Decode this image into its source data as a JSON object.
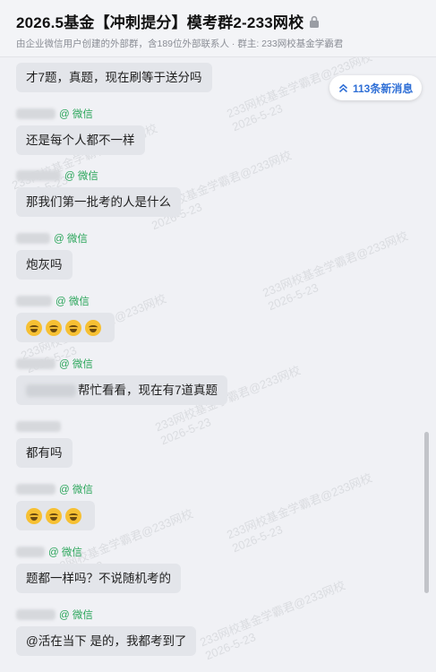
{
  "header": {
    "title": "2026.5基金【冲刺提分】模考群2-233网校",
    "subtitle": "由企业微信用户创建的外部群，含189位外部联系人 · 群主: 233网校基金学霸君"
  },
  "new_messages": {
    "label": "113条新消息"
  },
  "wechat_tag": "@ 微信",
  "messages": [
    {
      "text": "才7题，真题，现在刷等于送分吗"
    },
    {
      "text": "还是每个人都不一样"
    },
    {
      "text": "那我们第一批考的人是什么"
    },
    {
      "text": "炮灰吗"
    },
    {
      "emoji_count": 4
    },
    {
      "text": "帮忙看看，现在有7道真题"
    },
    {
      "text": "都有吗"
    },
    {
      "emoji_count": 3
    },
    {
      "text": "题都一样吗？不说随机考的"
    },
    {
      "text": "@活在当下 是的，我都考到了"
    }
  ],
  "watermark": {
    "line1": "233网校基金学霸君@233网校",
    "line2": "2026-5-23"
  }
}
